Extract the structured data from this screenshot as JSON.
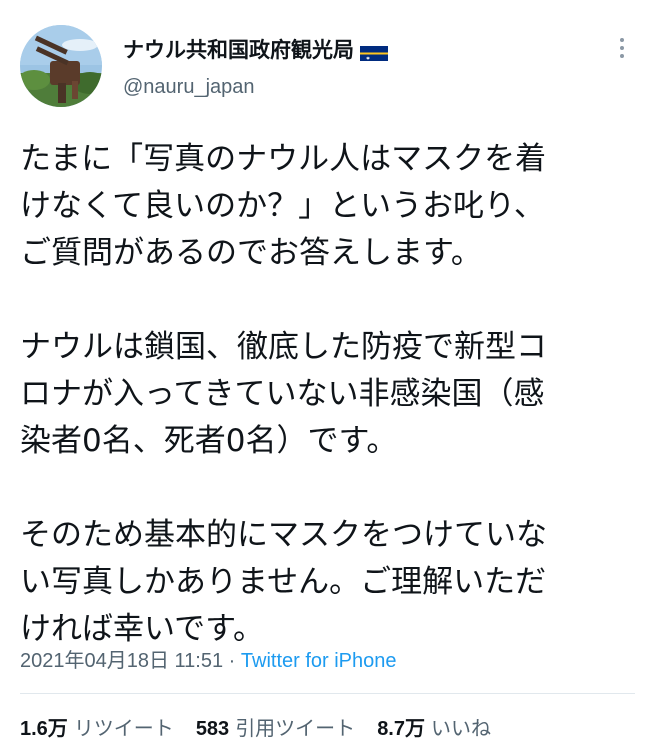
{
  "author": {
    "display_name": "ナウル共和国政府観光局",
    "handle": "@nauru_japan",
    "flag_icon": "nauru-flag-icon",
    "avatar_icon": "avatar-photo-icon"
  },
  "tweet": {
    "lines": [
      "たまに「写真のナウル人はマスクを着",
      "けなくて良いのか？」というお叱り、",
      "ご質問があるのでお答えします。",
      "",
      "ナウルは鎖国、徹底した防疫で新型コ",
      "ロナが入ってきていない非感染国（感",
      "染者0名、死者0名）です。",
      "",
      "そのため基本的にマスクをつけていな",
      "い写真しかありません。ご理解いただ",
      "ければ幸いです。"
    ]
  },
  "meta": {
    "timestamp": "2021年04月18日 11:51",
    "separator": " · ",
    "source": "Twitter for iPhone"
  },
  "stats": {
    "retweets_count": "1.6万",
    "retweets_label": "リツイート",
    "quotes_count": "583",
    "quotes_label": "引用ツイート",
    "likes_count": "8.7万",
    "likes_label": "いいね"
  },
  "colors": {
    "text": "#0f1419",
    "secondary": "#536471",
    "link": "#1d9bf0",
    "divider": "#e1e8ed",
    "flag_blue": "#002b7f",
    "flag_yellow": "#ffc61e"
  }
}
